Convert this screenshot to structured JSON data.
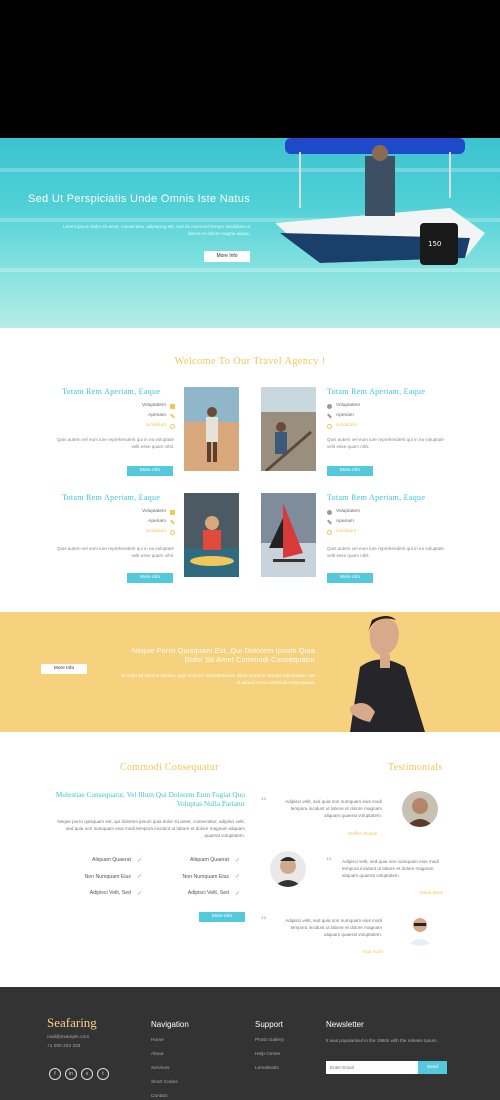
{
  "hero": {
    "title": "Sed Ut Perspiciatis Unde Omnis Iste Natus",
    "text": "Lorem ipsum dolor sit amet, consectetur adipiscing elit, sed do eiusmod tempor incididunt ut labore et dolore magna aliqua.",
    "button": "More Info"
  },
  "welcome": {
    "title": "Welcome To Our Travel Agency !",
    "cards": [
      {
        "title": "Totam Rem Aperiam, Eaque",
        "meta": [
          "Voluptatem",
          "Aperiam",
          "incididunt"
        ],
        "text": "Quis autem vel eum iure reprehenderit qui in ea voluptate velit esse quam nihil.",
        "button": "More Info"
      },
      {
        "title": "Totam Rem Aperiam, Eaque",
        "meta": [
          "Voluptatem",
          "Aperiam",
          "incididunt"
        ],
        "text": "Quis autem vel eum iure reprehenderit qui in ea voluptate velit esse quam nihil.",
        "button": "More Info"
      },
      {
        "title": "Totam Rem Aperiam, Eaque",
        "meta": [
          "Voluptatem",
          "Aperiam",
          "incididunt"
        ],
        "text": "Quis autem vel eum iure reprehenderit qui in ea voluptate velit esse quam nihil.",
        "button": "More Info"
      },
      {
        "title": "Totam Rem Aperiam, Eaque",
        "meta": [
          "Voluptatem",
          "Aperiam",
          "incididunt"
        ],
        "text": "Quis autem vel eum iure reprehenderit qui in ea voluptate velit esse quam nihil.",
        "button": "More Info"
      }
    ]
  },
  "band": {
    "title": "Neque Porro Quisquam Est, Qui Dolorem Ipsum Quia Dolor Sit Amet Commodi Consequatur",
    "text": "Ut enim ad minima veniam, quis nostrum exercitationem ullam corporis suscipit laboriosam, nisi ut aliquid ex ea commodi consequatur.",
    "button": "More Info"
  },
  "commodi": {
    "title": "Commodi Consequatur",
    "subtitle": "Molestiae Consequatur, Vel Illum Qui Dolorem Eum Fugiat Quo Voluptas Nulla Pariatur",
    "text": "Neque porro quisquam est, qui dolorem ipsum quia dolor sit amet, consectetur, adipisci velit, sed quia non numquam eius modi tempora incidunt ut labore et dolore magnam aliquam quaerat voluptatem.",
    "list_left": [
      "Aliquam Quaerat",
      "Non Numquam Eius",
      "Adipisci Velit, Sed"
    ],
    "list_right": [
      "Aliquam Quaerat",
      "Non Numquam Eius",
      "Adipisci Velit, Sed"
    ],
    "button": "More Info"
  },
  "testimonials": {
    "title": "Testimonials",
    "items": [
      {
        "text": "Adipisci velit, sed quia non numquam eius modi tempora incidunt ut labore et dolore magnam aliquam quaerat voluptatem.",
        "name": "Steffen Rohde"
      },
      {
        "text": "Adipisci velit, sed quia non numquam eius modi tempora incidunt ut labore et dolore magnam aliquam quaerat voluptatem.",
        "name": "Maria Buck"
      },
      {
        "text": "Adipisci velit, sed quia non numquam eius modi tempora incidunt ut labore et dolore magnam aliquam quaerat voluptatem.",
        "name": "Anja Koch"
      }
    ]
  },
  "footer": {
    "brand": "Seafaring",
    "email": "mail@example.com",
    "phone": "+1 000 222 333",
    "social": [
      "f",
      "in",
      "v",
      "t"
    ],
    "nav_title": "Navigation",
    "nav": [
      "Home",
      "About",
      "Services",
      "Short Codes",
      "Contact"
    ],
    "support_title": "Support",
    "support": [
      "Photo Gallery",
      "Help Center",
      "Lemolisoils"
    ],
    "newsletter_title": "Newsletter",
    "newsletter_text": "It was popularised in the 1960s with the release Ipsum.",
    "newsletter_placeholder": "Enter Email",
    "newsletter_button": "Send"
  },
  "colors": {
    "accent_teal": "#55c9dc",
    "accent_yellow": "#f6d27e",
    "footer_bg": "#333333"
  }
}
